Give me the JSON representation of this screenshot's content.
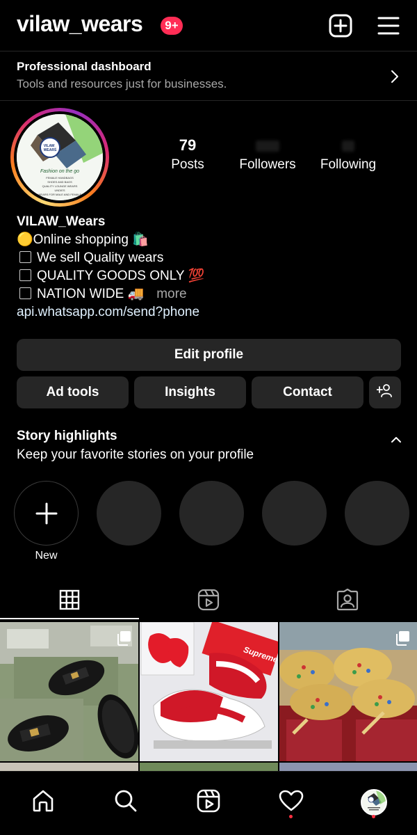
{
  "header": {
    "username": "vilaw_wears",
    "notification_badge": "9+",
    "create_icon": "plus-square-icon",
    "menu_icon": "hamburger-menu-icon"
  },
  "professional_dashboard": {
    "title": "Professional dashboard",
    "subtitle": "Tools and resources just for businesses."
  },
  "profile": {
    "avatar_logo_text": "VILAW_ WEARS",
    "avatar_tagline": "Fashion on the go",
    "avatar_lines": [
      "FEMALE HANDBAGS",
      "SHOES AND BAGS",
      "QUALITY LOUNGE WEARS",
      "UNDIES",
      "WEARS FOR MALE AND FEMALE"
    ],
    "stats": {
      "posts_count": "79",
      "posts_label": "Posts",
      "followers_label": "Followers",
      "following_label": "Following"
    }
  },
  "bio": {
    "display_name": "VILAW_Wears",
    "line1_emoji": "🟡",
    "line1_text": "Online shopping",
    "line1_emoji2": "🛍️",
    "line2_text": "We sell Quality wears",
    "line3_text": "QUALITY GOODS ONLY",
    "line3_emoji": "💯",
    "line4_text": "NATION WIDE",
    "line4_emoji": "🚚",
    "more_label": "more",
    "link": "api.whatsapp.com/send?phone"
  },
  "buttons": {
    "edit_profile": "Edit profile",
    "ad_tools": "Ad tools",
    "insights": "Insights",
    "contact": "Contact",
    "discover_people_icon": "add-person-icon"
  },
  "story_highlights": {
    "title": "Story highlights",
    "subtitle": "Keep your favorite stories on your profile",
    "new_label": "New"
  },
  "tabs": [
    {
      "name": "grid",
      "icon": "grid-icon",
      "active": true
    },
    {
      "name": "reels",
      "icon": "reels-icon",
      "active": false
    },
    {
      "name": "tagged",
      "icon": "tagged-person-icon",
      "active": false
    }
  ],
  "posts": [
    {
      "id": "post-1",
      "description": "black slides on green box",
      "multi": true
    },
    {
      "id": "post-2",
      "description": "red and white sneakers with Supreme box",
      "box_text": "Supreme",
      "multi": false
    },
    {
      "id": "post-3",
      "description": "gold studded sandals",
      "multi": true
    }
  ],
  "bottom_nav": [
    {
      "name": "home",
      "icon": "home-icon"
    },
    {
      "name": "search",
      "icon": "search-icon"
    },
    {
      "name": "reels",
      "icon": "reels-icon"
    },
    {
      "name": "activity",
      "icon": "heart-icon",
      "dot": true
    },
    {
      "name": "profile",
      "icon": "profile-avatar",
      "dot": true
    }
  ],
  "colors": {
    "background": "#000000",
    "button_bg": "#262626",
    "badge": "#ff2d55",
    "link": "#e0f1ff",
    "muted": "#a8a8a8"
  }
}
